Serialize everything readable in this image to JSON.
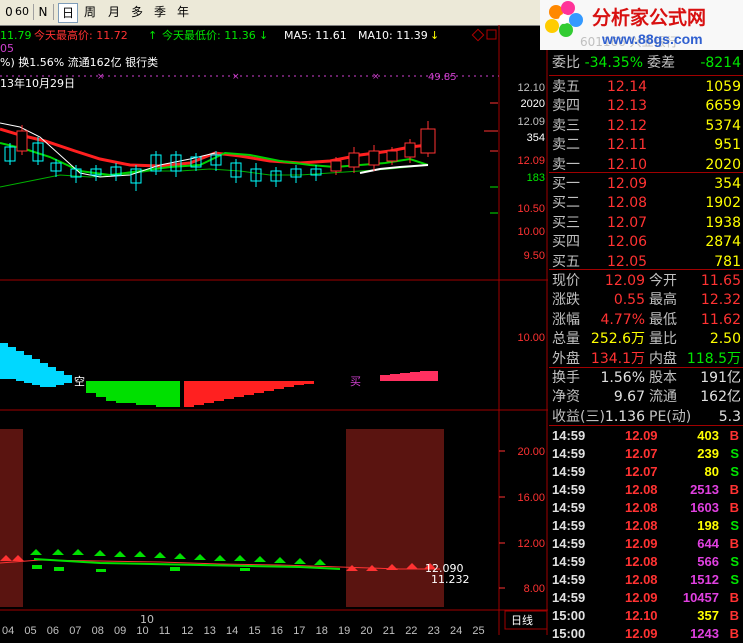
{
  "toolbar": {
    "items": [
      {
        "label": "0"
      },
      {
        "label": "60"
      },
      {
        "label": "N"
      },
      {
        "label": "日"
      },
      {
        "label": "周"
      },
      {
        "label": "月"
      },
      {
        "label": "多"
      },
      {
        "label": "季"
      },
      {
        "label": "年"
      }
    ]
  },
  "logo": {
    "brand": "分析家公式网",
    "url": "www.88gs.com",
    "ghost": "601166 兴业银行"
  },
  "chart": {
    "info_line": {
      "price": "11.79",
      "high_label": "今天最高价: 11.72",
      "low_label": "今天最低价: 11.36",
      "ma5": "MA5: 11.61",
      "ma10": "MA10: 11.39"
    },
    "sub_line": "05",
    "turnover_line": "%) 换1.56% 流通162亿 银行类",
    "date_label": "13年10月29日",
    "top_mark": "49.85",
    "markers": {
      "sell": "空",
      "buy": "买"
    },
    "last_values": [
      "12.090",
      "11.232"
    ],
    "x_axis_month": "10",
    "x_ticks": [
      "04",
      "05",
      "06",
      "07",
      "08",
      "09",
      "10",
      "11",
      "12",
      "13",
      "14",
      "15",
      "16",
      "17",
      "18",
      "19",
      "20",
      "21",
      "22",
      "23",
      "24",
      "25"
    ],
    "main_axis": [
      "12.10",
      "2020",
      "12.09",
      "354",
      "12.09",
      "183",
      "10.50",
      "10.00",
      "9.50"
    ],
    "mid_axis": [
      "10.00"
    ],
    "low_axis": [
      "20.00",
      "16.00",
      "12.00",
      "8.00"
    ],
    "period_label": "日线",
    "colors": {
      "up": "#ff3232",
      "down": "#00ffff",
      "ma5": "#ffffff",
      "ma10": "#00c800",
      "ma20": "#ff0000"
    }
  },
  "panel": {
    "weibi": {
      "label": "委比",
      "value": "-34.35%",
      "label2": "委差",
      "value2": "-8214"
    },
    "asks": [
      {
        "label": "卖五",
        "price": "12.14",
        "vol": "1059"
      },
      {
        "label": "卖四",
        "price": "12.13",
        "vol": "6659"
      },
      {
        "label": "卖三",
        "price": "12.12",
        "vol": "5374"
      },
      {
        "label": "卖二",
        "price": "12.11",
        "vol": "951"
      },
      {
        "label": "卖一",
        "price": "12.10",
        "vol": "2020"
      }
    ],
    "bids": [
      {
        "label": "买一",
        "price": "12.09",
        "vol": "354"
      },
      {
        "label": "买二",
        "price": "12.08",
        "vol": "1902"
      },
      {
        "label": "买三",
        "price": "12.07",
        "vol": "1938"
      },
      {
        "label": "买四",
        "price": "12.06",
        "vol": "2874"
      },
      {
        "label": "买五",
        "price": "12.05",
        "vol": "781"
      }
    ],
    "stats1": [
      {
        "l1": "现价",
        "v1": "12.09",
        "l2": "今开",
        "v2": "11.65"
      },
      {
        "l1": "涨跌",
        "v1": "0.55",
        "l2": "最高",
        "v2": "12.32"
      },
      {
        "l1": "涨幅",
        "v1": "4.77%",
        "l2": "最低",
        "v2": "11.62"
      },
      {
        "l1": "总量",
        "v1": "252.6万",
        "l2": "量比",
        "v2": "2.50"
      },
      {
        "l1": "外盘",
        "v1": "134.1万",
        "l2": "内盘",
        "v2": "118.5万"
      }
    ],
    "stats2": [
      {
        "l1": "换手",
        "v1": "1.56%",
        "l2": "股本",
        "v2": "191亿"
      },
      {
        "l1": "净资",
        "v1": "9.67",
        "l2": "流通",
        "v2": "162亿"
      },
      {
        "l1": "收益(三)",
        "v1": "1.136",
        "l2": "PE(动)",
        "v2": "5.3"
      }
    ],
    "ticks": [
      {
        "time": "14:59",
        "price": "12.09",
        "vol": "403",
        "side": "B"
      },
      {
        "time": "14:59",
        "price": "12.07",
        "vol": "239",
        "side": "S"
      },
      {
        "time": "14:59",
        "price": "12.07",
        "vol": "80",
        "side": "S"
      },
      {
        "time": "14:59",
        "price": "12.08",
        "vol": "2513",
        "side": "B"
      },
      {
        "time": "14:59",
        "price": "12.08",
        "vol": "1603",
        "side": "B"
      },
      {
        "time": "14:59",
        "price": "12.08",
        "vol": "198",
        "side": "S"
      },
      {
        "time": "14:59",
        "price": "12.09",
        "vol": "644",
        "side": "B"
      },
      {
        "time": "14:59",
        "price": "12.08",
        "vol": "566",
        "side": "S"
      },
      {
        "time": "14:59",
        "price": "12.08",
        "vol": "1512",
        "side": "S"
      },
      {
        "time": "14:59",
        "price": "12.09",
        "vol": "10457",
        "side": "B"
      },
      {
        "time": "15:00",
        "price": "12.10",
        "vol": "357",
        "side": "B"
      },
      {
        "time": "15:00",
        "price": "12.09",
        "vol": "1243",
        "side": "B"
      }
    ]
  }
}
